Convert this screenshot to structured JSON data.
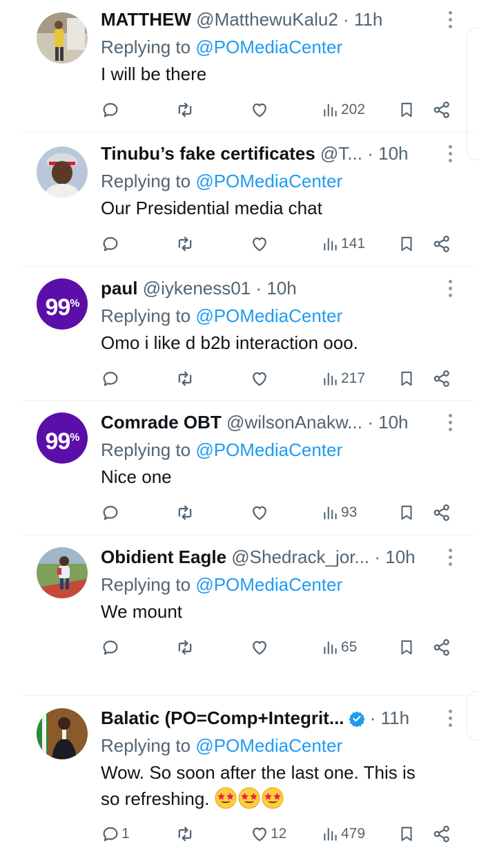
{
  "tweets": [
    {
      "name": "MATTHEW",
      "handle": "@MatthewuKalu2",
      "time": "11h",
      "replying_prefix": "Replying to",
      "mention": "@POMediaCenter",
      "text": "I will be there",
      "replies": "",
      "likes": "",
      "views": "202",
      "avatar": "photo-worker"
    },
    {
      "name": "Tinubu’s fake certificates",
      "handle": "@T...",
      "time": "10h",
      "replying_prefix": "Replying to",
      "mention": "@POMediaCenter",
      "text": "Our Presidential media chat",
      "replies": "",
      "likes": "",
      "views": "141",
      "avatar": "photo-man-cap"
    },
    {
      "name": "paul",
      "handle": "@iykeness01",
      "time": "10h",
      "replying_prefix": "Replying to",
      "mention": "@POMediaCenter",
      "text": "Omo i like d b2b interaction ooo.",
      "replies": "",
      "likes": "",
      "views": "217",
      "avatar": "99-percent-badge",
      "avatar_text": "99",
      "avatar_sup": "%"
    },
    {
      "name": "Comrade OBT",
      "handle": "@wilsonAnakw...",
      "time": "10h",
      "replying_prefix": "Replying to",
      "mention": "@POMediaCenter",
      "text": "Nice one",
      "replies": "",
      "likes": "",
      "views": "93",
      "avatar": "99-percent-badge",
      "avatar_text": "99",
      "avatar_sup": "%"
    },
    {
      "name": "Obidient Eagle",
      "handle": "@Shedrack_jor...",
      "time": "10h",
      "replying_prefix": "Replying to",
      "mention": "@POMediaCenter",
      "text": "We mount",
      "replies": "",
      "likes": "",
      "views": "65",
      "avatar": "photo-child"
    },
    {
      "name": "Balatic (PO=Comp+Integrit...",
      "handle": "",
      "time": "11h",
      "verified": true,
      "replying_prefix": "Replying to",
      "mention": "@POMediaCenter",
      "text_line1": "Wow. So soon after the last one. This is",
      "text_line2": "so refreshing.",
      "emoji": [
        "star-struck-emoji",
        "star-struck-emoji",
        "star-struck-emoji"
      ],
      "replies": "1",
      "likes": "12",
      "views": "479",
      "avatar": "photo-speaker"
    }
  ],
  "dot": "·",
  "colors": {
    "link": "#1d9bf0",
    "muted": "#536471",
    "badge_purple": "#5b0fa8",
    "verified": "#1d9bf0"
  },
  "icons": [
    "reply-icon",
    "retweet-icon",
    "like-icon",
    "views-icon",
    "bookmark-icon",
    "share-icon",
    "more-icon",
    "verified-badge-icon"
  ]
}
